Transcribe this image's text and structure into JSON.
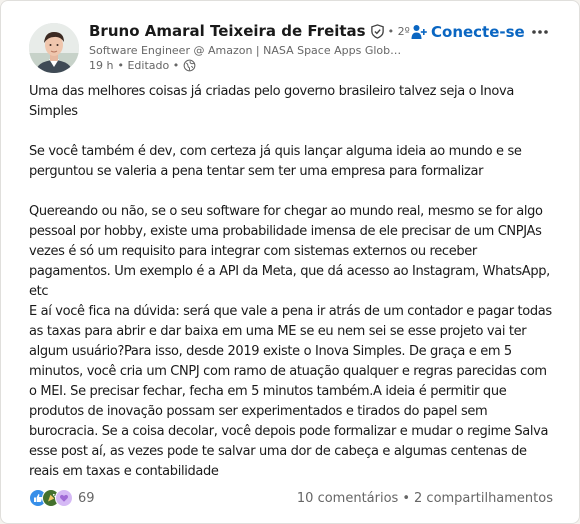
{
  "author": {
    "name": "Bruno Amaral Teixeira de Freitas",
    "degree": "• 2º",
    "headline": "Software Engineer @ Amazon | NASA Space Apps Global Nominee",
    "time": "19 h",
    "edited": "• Editado •"
  },
  "actions": {
    "connect_label": "Conecte-se"
  },
  "post": {
    "paragraphs": [
      "Uma das melhores coisas já criadas pelo governo brasileiro talvez seja o Inova Simples",
      "Se você também é dev, com certeza já quis lançar alguma ideia ao mundo e se perguntou se valeria a pena tentar sem ter uma empresa para formalizar",
      "Quereando ou não, se o seu software for chegar ao mundo real, mesmo se for algo pessoal por hobby, existe uma probabilidade imensa de ele precisar de um CNPJAs vezes é só um requisito para integrar com sistemas externos ou receber pagamentos. Um exemplo é a API da Meta, que dá acesso ao Instagram, WhatsApp, etc",
      "E aí você fica na dúvida: será que vale a pena ir atrás de um contador e pagar todas as taxas para abrir e dar baixa em uma ME se eu nem sei se esse projeto vai ter algum usuário?Para isso, desde 2019 existe o Inova Simples. De graça e em 5 minutos, você cria um CNPJ com ramo de atuação qualquer e regras parecidas com o MEI. Se precisar fechar, fecha em 5 minutos também.A ideia é permitir que produtos de inovação possam ser experimentados e tirados do papel sem burocracia. Se a coisa decolar, você depois pode formalizar e mudar o regime Salva esse post aí, as vezes pode te salvar uma dor de cabeça e algumas centenas de reais em taxas e contabilidade"
    ]
  },
  "social": {
    "reaction_count": "69",
    "comments": "10 comentários",
    "separator": "•",
    "shares": "2 compartilhamentos"
  },
  "icons": {
    "verified": "shield-check-icon",
    "connect": "add-person-icon",
    "more": "more-horizontal-icon",
    "visibility": "globe-icon",
    "reactions": [
      "like-icon",
      "celebrate-icon",
      "support-icon"
    ]
  },
  "colors": {
    "link_blue": "#0a66c2",
    "like": "#378fe9",
    "celebrate": "#44712e",
    "support": "#d5b9f5"
  }
}
